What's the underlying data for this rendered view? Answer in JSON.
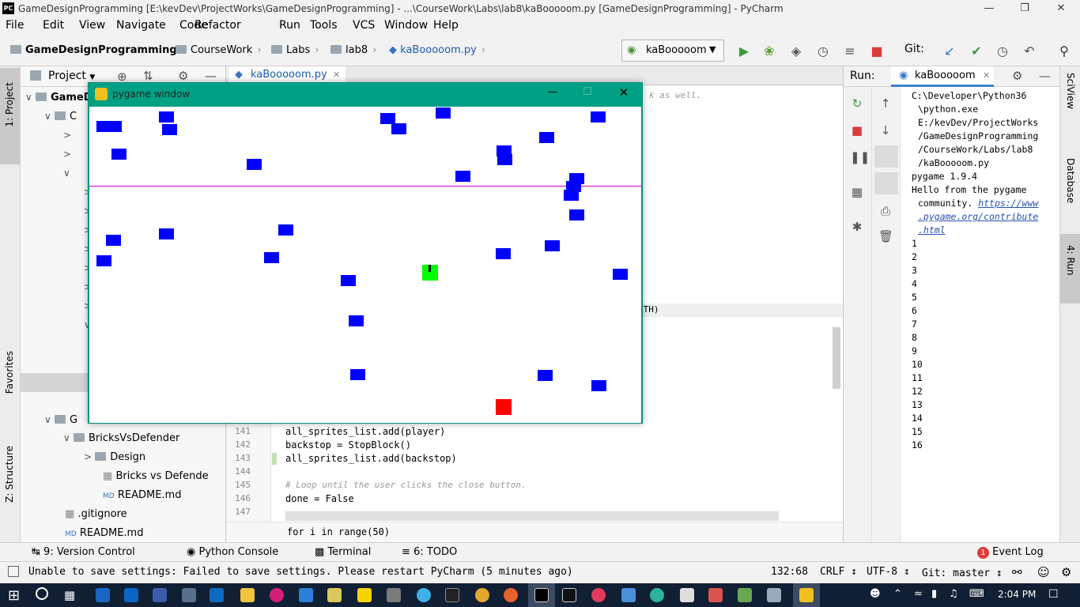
{
  "window": {
    "title": "GameDesignProgramming [E:\\kevDev\\ProjectWorks\\GameDesignProgramming] - ...\\CourseWork\\Labs\\lab8\\kaBooooom.py [GameDesignProgramming] - PyCharm",
    "app_icon": "PC"
  },
  "menu": [
    "File",
    "Edit",
    "View",
    "Navigate",
    "Code",
    "Refactor",
    "Run",
    "Tools",
    "VCS",
    "Window",
    "Help"
  ],
  "breadcrumbs": [
    "GameDesignProgramming",
    "CourseWork",
    "Labs",
    "lab8",
    "kaBooooom.py"
  ],
  "run_config": "kaBooooom",
  "git_label": "Git:",
  "project_panel": {
    "title": "Project",
    "items": [
      "GameD",
      "C",
      "G",
      "BricksVsDefender",
      "Design",
      "Bricks vs Defende",
      "README.md",
      ".gitignore",
      "README.md"
    ]
  },
  "editor": {
    "tab": "kaBooooom.py",
    "line_numbers": [
      "141",
      "142",
      "143",
      "144",
      "145",
      "146",
      "147"
    ],
    "lines": [
      "all_sprites_list.add(player)",
      "backstop = StopBlock()",
      "all_sprites_list.add(backstop)",
      "",
      "# Loop until the user clicks the close button.",
      "done = False",
      ""
    ],
    "visible_fragments": {
      "comment_tail": "k as well.",
      "width_tail": "DTH)"
    },
    "footer": "for i in range(50)"
  },
  "run_panel": {
    "label": "Run:",
    "tab": "kaBooooom",
    "output": [
      "C:\\Developer\\Python36",
      "\\python.exe",
      "E:/kevDev/ProjectWorks",
      "/GameDesignProgramming",
      "/CourseWork/Labs/lab8",
      "/kaBooooom.py",
      "pygame 1.9.4",
      "Hello from the pygame",
      "community."
    ],
    "link": [
      "https://www",
      ".pygame.org/contribute",
      ".html"
    ],
    "numbers": [
      "1",
      "2",
      "3",
      "4",
      "5",
      "6",
      "7",
      "8",
      "9",
      "10",
      "11",
      "12",
      "13",
      "14",
      "15",
      "16"
    ]
  },
  "left_strip": [
    "1: Project",
    "Favorites",
    "Z: Structure"
  ],
  "right_strip": [
    "SciView",
    "Database",
    "4: Run"
  ],
  "tool_windows": {
    "version_control": "9: Version Control",
    "python_console": "Python Console",
    "terminal": "Terminal",
    "todo": "6: TODO",
    "event_log": "Event Log",
    "event_count": "1"
  },
  "status": {
    "message": "Unable to save settings: Failed to save settings. Please restart PyCharm (5 minutes ago)",
    "position": "132:68",
    "line_sep": "CRLF ↕",
    "encoding": "UTF-8 ↕",
    "git": "Git: master ↕"
  },
  "taskbar": {
    "time": "2:04 PM"
  },
  "pygame": {
    "title": "pygame window",
    "colors": {
      "block": "#0000ff",
      "player": "#00ff00",
      "backstop": "#ff0000",
      "line": "#cc00cc"
    }
  }
}
